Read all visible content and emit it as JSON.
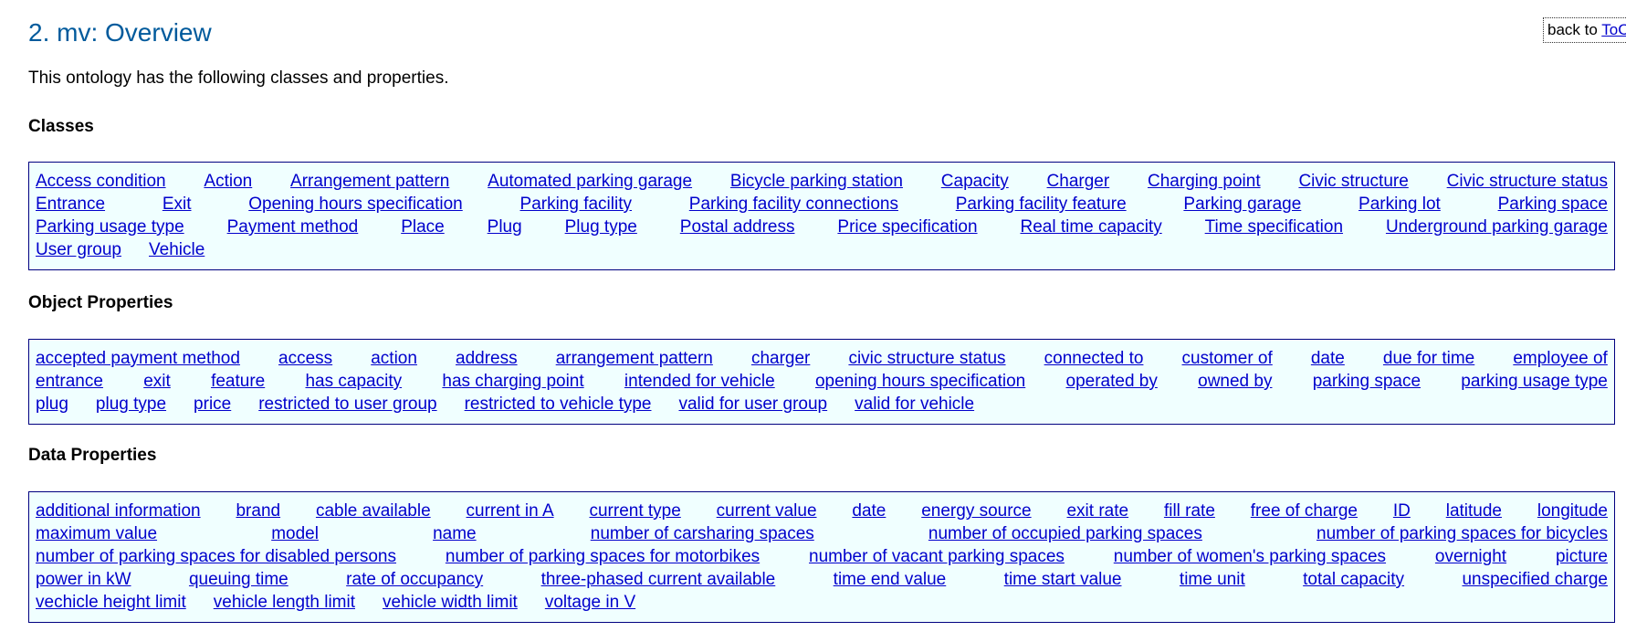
{
  "header": {
    "title": "2. mv: Overview",
    "back_prefix": "back to ",
    "back_link": "ToC"
  },
  "intro": "This ontology has the following classes and properties.",
  "sections": [
    {
      "heading": "Classes",
      "rows": [
        [
          "Access condition",
          "Action",
          "Arrangement pattern",
          "Automated parking garage",
          "Bicycle parking station",
          "Capacity",
          "Charger",
          "Charging point",
          "Civic structure",
          "Civic structure status"
        ],
        [
          "Entrance",
          "Exit",
          "Opening hours specification",
          "Parking facility",
          "Parking facility connections",
          "Parking facility feature",
          "Parking garage",
          "Parking lot",
          "Parking space"
        ],
        [
          "Parking usage type",
          "Payment method",
          "Place",
          "Plug",
          "Plug type",
          "Postal address",
          "Price specification",
          "Real time capacity",
          "Time specification",
          "Underground parking garage"
        ],
        [
          "User group",
          "Vehicle"
        ]
      ]
    },
    {
      "heading": "Object Properties",
      "rows": [
        [
          "accepted payment method",
          "access",
          "action",
          "address",
          "arrangement pattern",
          "charger",
          "civic structure status",
          "connected to",
          "customer of",
          "date",
          "due for time",
          "employee of"
        ],
        [
          "entrance",
          "exit",
          "feature",
          "has capacity",
          "has charging point",
          "intended for vehicle",
          "opening hours specification",
          "operated by",
          "owned by",
          "parking space",
          "parking usage type"
        ],
        [
          "plug",
          "plug type",
          "price",
          "restricted to user group",
          "restricted to vehicle type",
          "valid for user group",
          "valid for vehicle"
        ]
      ]
    },
    {
      "heading": "Data Properties",
      "rows": [
        [
          "additional information",
          "brand",
          "cable available",
          "current in A",
          "current type",
          "current value",
          "date",
          "energy source",
          "exit rate",
          "fill rate",
          "free of charge",
          "ID",
          "latitude",
          "longitude"
        ],
        [
          "maximum value",
          "model",
          "name",
          "number of carsharing spaces",
          "number of occupied parking spaces",
          "number of parking spaces for bicycles"
        ],
        [
          "number of parking spaces for disabled persons",
          "number of parking spaces for motorbikes",
          "number of vacant parking spaces",
          "number of women's parking spaces",
          "overnight",
          "picture"
        ],
        [
          "power in kW",
          "queuing time",
          "rate of occupancy",
          "three-phased current available",
          "time end value",
          "time start value",
          "time unit",
          "total capacity",
          "unspecified charge"
        ],
        [
          "vechicle height limit",
          "vehicle length limit",
          "vehicle width limit",
          "voltage in V"
        ]
      ]
    }
  ],
  "colors": {
    "title": "#005a9c",
    "link": "#0000cc",
    "box_bg": "#f0ffff",
    "box_border": "#000080"
  }
}
